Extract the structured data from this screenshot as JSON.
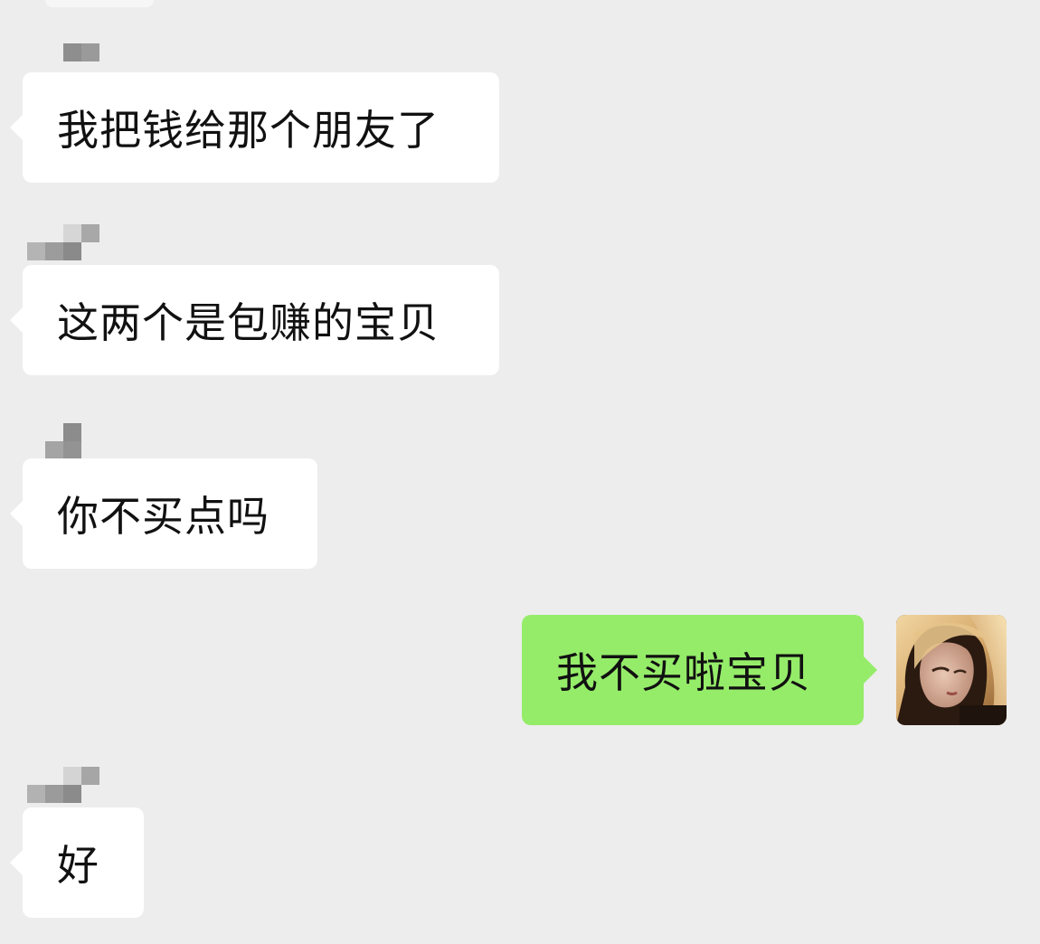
{
  "conversation": {
    "messages": [
      {
        "direction": "incoming",
        "text": "我把钱给那个朋友了"
      },
      {
        "direction": "incoming",
        "text": "这两个是包赚的宝贝"
      },
      {
        "direction": "incoming",
        "text": "你不买点吗"
      },
      {
        "direction": "outgoing",
        "text": "我不买啦宝贝"
      },
      {
        "direction": "incoming",
        "text": "好"
      }
    ]
  },
  "colors": {
    "background": "#ededed",
    "incoming_bubble": "#ffffff",
    "outgoing_bubble": "#95ec69",
    "text": "#111111"
  },
  "icons": {
    "sender_name": "pixelated-name-redaction",
    "self_avatar": "user-avatar-photo"
  }
}
